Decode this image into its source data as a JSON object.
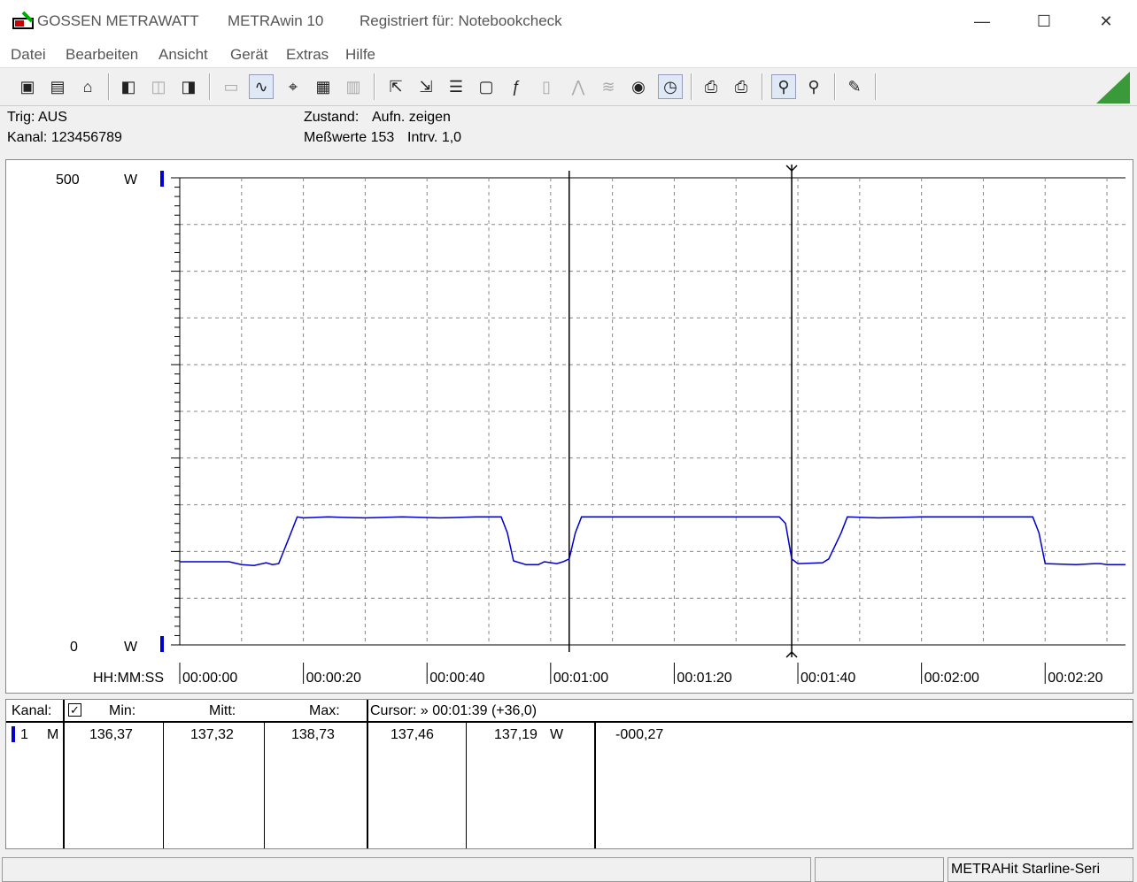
{
  "window": {
    "app_name": "GOSSEN METRAWATT",
    "version": "METRAwin 10",
    "registration": "Registriert für: Notebookcheck",
    "minimize": "—",
    "maximize": "☐",
    "close": "✕"
  },
  "menu": [
    "Datei",
    "Bearbeiten",
    "Ansicht",
    "Gerät",
    "Extras",
    "Hilfe"
  ],
  "info": {
    "trig": "Trig: AUS",
    "kanal": "Kanal: 123456789",
    "zustand_label": "Zustand:",
    "zustand_value": "Aufn. zeigen",
    "messwerte": "Meßwerte 153",
    "intervall": "Intrv. 1,0"
  },
  "chart_labels": {
    "y_top": "500",
    "y_top_unit": "W",
    "y_bottom": "0",
    "y_bottom_unit": "W",
    "x_axis_label": "HH:MM:SS"
  },
  "chart_data": {
    "type": "line",
    "ylim": [
      0,
      500
    ],
    "xlim": [
      0,
      153
    ],
    "x_ticks": [
      "00:00:00",
      "00:00:20",
      "00:00:40",
      "00:01:00",
      "00:01:20",
      "00:01:40",
      "00:02:00",
      "00:02:20"
    ],
    "x_tick_values": [
      0,
      20,
      40,
      60,
      80,
      100,
      120,
      140
    ],
    "series": [
      {
        "color": "#0000cc",
        "points": [
          [
            0,
            89
          ],
          [
            8,
            89
          ],
          [
            10,
            86
          ],
          [
            12,
            85
          ],
          [
            14,
            88
          ],
          [
            15,
            86
          ],
          [
            16,
            87
          ],
          [
            18,
            120
          ],
          [
            19,
            137
          ],
          [
            20,
            136
          ],
          [
            24,
            137
          ],
          [
            30,
            136
          ],
          [
            36,
            137
          ],
          [
            42,
            136
          ],
          [
            48,
            137
          ],
          [
            52,
            137
          ],
          [
            53,
            120
          ],
          [
            54,
            90
          ],
          [
            56,
            86
          ],
          [
            58,
            86
          ],
          [
            59,
            89
          ],
          [
            61,
            87
          ],
          [
            62,
            89
          ],
          [
            63,
            92
          ],
          [
            64,
            120
          ],
          [
            65,
            137
          ],
          [
            70,
            137
          ],
          [
            80,
            137
          ],
          [
            90,
            137
          ],
          [
            96,
            137
          ],
          [
            97,
            137
          ],
          [
            98,
            130
          ],
          [
            99,
            92
          ],
          [
            100,
            87
          ],
          [
            104,
            88
          ],
          [
            105,
            92
          ],
          [
            107,
            120
          ],
          [
            108,
            137
          ],
          [
            113,
            136
          ],
          [
            120,
            137
          ],
          [
            130,
            137
          ],
          [
            136,
            137
          ],
          [
            138,
            137
          ],
          [
            139,
            120
          ],
          [
            140,
            87
          ],
          [
            145,
            86
          ],
          [
            148,
            87
          ],
          [
            149,
            87
          ],
          [
            150,
            86
          ],
          [
            153,
            86
          ]
        ]
      }
    ],
    "cursors": [
      63,
      99
    ],
    "grid": true
  },
  "table": {
    "headers": {
      "kanal": "Kanal:",
      "min": "Min:",
      "mitt": "Mitt:",
      "max": "Max:",
      "cursor": "Cursor: » 00:01:39 (+36,0)"
    },
    "row": {
      "channel": "1",
      "mode": "M",
      "min": "136,37",
      "mitt": "137,32",
      "max": "138,73",
      "cursor_val1": "137,46",
      "cursor_val2": "137,19",
      "unit": "W",
      "diff": "-000,27"
    }
  },
  "status": {
    "device": "METRAHit Starline-Seri"
  },
  "colors": {
    "trace": "#0000cc",
    "channel_marker": "#0000cc"
  }
}
